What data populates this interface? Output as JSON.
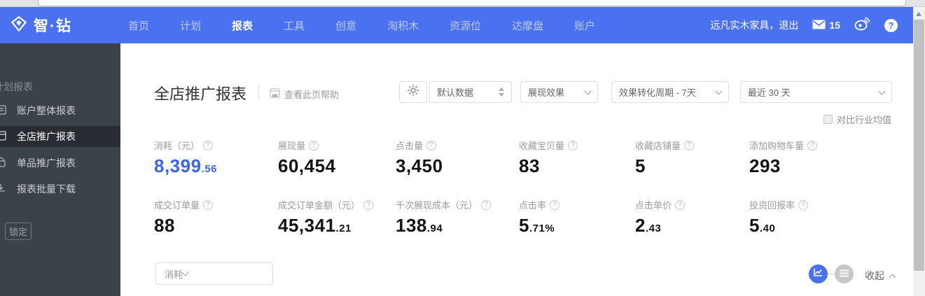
{
  "colors": {
    "navbar_blue": "#4a71ef",
    "value_blue": "#3b64e9",
    "sidebar_bg": "#3c424a",
    "sidebar_active_bg": "#292d33",
    "scrollbar_thumb": "#c1c1c1"
  },
  "navbar": {
    "logo_text": "智·钻",
    "menu": [
      "首页",
      "计划",
      "报表",
      "工具",
      "创意",
      "淘积木",
      "资源位",
      "达摩盘",
      "账户"
    ],
    "active_menu": "报表",
    "user_link": "远凡实木家具，退出",
    "mail_count": "15",
    "help_label": "?"
  },
  "sidebar": {
    "section_label": "计划报表",
    "items": [
      {
        "label": "账户整体报表",
        "active": false
      },
      {
        "label": "全店推广报表",
        "active": true
      },
      {
        "label": "单品推广报表",
        "active": false
      },
      {
        "label": "报表批量下载",
        "active": false
      }
    ],
    "lock_label": "锁定"
  },
  "main": {
    "title": "全店推广报表",
    "help_link": "查看此页帮助",
    "filters": {
      "data_select": "默认数据",
      "effect_select": "展现效果",
      "period_select": "效果转化周期 - 7天",
      "date_select": "最近 30 天",
      "compare_label": "对比行业均值"
    },
    "metrics": [
      {
        "label": "消耗（元）",
        "value": "8,399",
        "decimal": ".56"
      },
      {
        "label": "展现量",
        "value": "60,454",
        "decimal": ""
      },
      {
        "label": "点击量",
        "value": "3,450",
        "decimal": ""
      },
      {
        "label": "收藏宝贝量",
        "value": "83",
        "decimal": ""
      },
      {
        "label": "收藏店铺量",
        "value": "5",
        "decimal": ""
      },
      {
        "label": "添加购物车量",
        "value": "293",
        "decimal": ""
      },
      {
        "label": "成交订单量",
        "value": "88",
        "decimal": ""
      },
      {
        "label": "成交订单金额（元）",
        "value": "45,341",
        "decimal": ".21"
      },
      {
        "label": "千次展现成本（元）",
        "value": "138",
        "decimal": ".94"
      },
      {
        "label": "点击率",
        "value": "5",
        "decimal": ".71%"
      },
      {
        "label": "点击单价",
        "value": "2",
        "decimal": ".43"
      },
      {
        "label": "投资回报率",
        "value": "5",
        "decimal": ".40"
      }
    ],
    "chart_bar": {
      "metric_select": "消耗",
      "collapse_label": "收起"
    }
  },
  "icons": {
    "logo": "gem-icon",
    "mail": "envelope-icon",
    "social": "weibo-icon",
    "help": "question-circle-icon",
    "settings": "gear-icon",
    "chart_line": "line-chart-icon",
    "chart_list": "list-icon"
  }
}
